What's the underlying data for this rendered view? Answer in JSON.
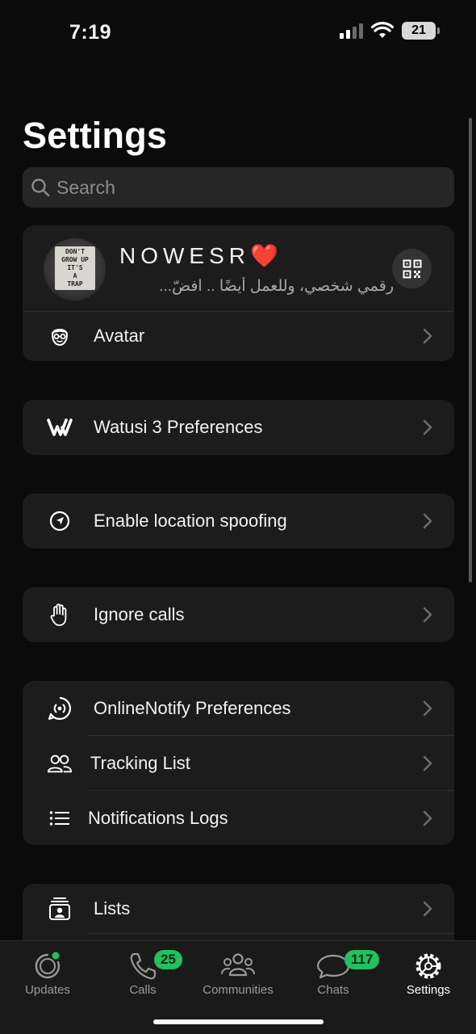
{
  "status_bar": {
    "time": "7:19",
    "battery": "21"
  },
  "page": {
    "title": "Settings"
  },
  "search": {
    "placeholder": "Search"
  },
  "profile": {
    "name": "NOWESR❤️",
    "status": "رقمي شخصي، وللعمل أيضًا .. افضّ...",
    "avatar_text": [
      "DON'T",
      "GROW UP",
      "IT'S",
      "A",
      "TRAP"
    ]
  },
  "sections": {
    "avatar": {
      "label": "Avatar"
    },
    "watusi": {
      "label": "Watusi 3 Preferences"
    },
    "location": {
      "label": "Enable location spoofing"
    },
    "ignore": {
      "label": "Ignore calls"
    },
    "online_notify": {
      "label": "OnlineNotify Preferences"
    },
    "tracking": {
      "label": "Tracking List"
    },
    "logs": {
      "label": "Notifications Logs"
    },
    "lists": {
      "label": "Lists"
    }
  },
  "tabbar": {
    "updates": {
      "label": "Updates"
    },
    "calls": {
      "label": "Calls",
      "badge": "25"
    },
    "communities": {
      "label": "Communities"
    },
    "chats": {
      "label": "Chats",
      "badge": "117"
    },
    "settings": {
      "label": "Settings"
    }
  },
  "colors": {
    "accent": "#22c15e",
    "card": "#1c1c1c",
    "background": "#0b0b0b"
  }
}
